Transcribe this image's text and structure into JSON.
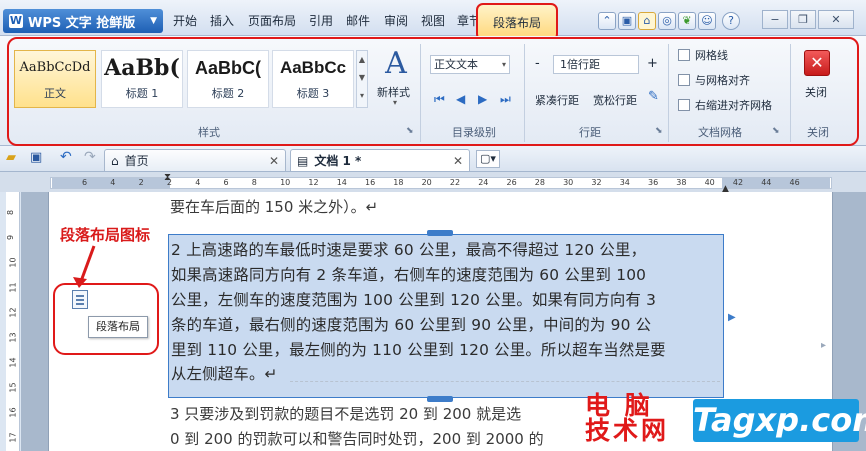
{
  "app": {
    "name": "WPS 文字 抢鲜版"
  },
  "menu": {
    "items": [
      "开始",
      "插入",
      "页面布局",
      "引用",
      "邮件",
      "审阅",
      "视图",
      "章节"
    ],
    "active": "段落布局"
  },
  "ribbon": {
    "styles": {
      "cards": [
        {
          "sample": "AaBbCcDd",
          "name": "正文"
        },
        {
          "sample": "AaBb(",
          "name": "标题 1"
        },
        {
          "sample": "AaBbC(",
          "name": "标题 2"
        },
        {
          "sample": "AaBbCc",
          "name": "标题 3"
        }
      ],
      "new_style": "新样式",
      "group_label": "样式"
    },
    "outline": {
      "select_value": "正文文本",
      "group_label": "目录级别"
    },
    "spacing": {
      "select_value": "1倍行距",
      "minus": "-",
      "plus": "+",
      "tight": "紧凑行距",
      "loose": "宽松行距",
      "group_label": "行距"
    },
    "grid": {
      "checkboxes": [
        "网格线",
        "与网格对齐",
        "右缩进对齐网格"
      ],
      "group_label": "文档网格"
    },
    "close": {
      "label": "关闭",
      "group_label": "关闭"
    }
  },
  "tabs": [
    {
      "label": "首页"
    },
    {
      "label": "文档 1 *"
    }
  ],
  "ruler": {
    "h_numbers": [
      "6",
      "4",
      "2",
      "2",
      "4",
      "6",
      "8",
      "10",
      "12",
      "14",
      "16",
      "18",
      "20",
      "22",
      "24",
      "26",
      "28",
      "30",
      "32",
      "34",
      "36",
      "38",
      "40",
      "42",
      "44",
      "46"
    ],
    "v_numbers": [
      "8",
      "9",
      "10",
      "11",
      "12",
      "13",
      "14",
      "15",
      "16",
      "17",
      "18"
    ]
  },
  "document": {
    "top_line": "要在车后面的 150 米之外）。↵",
    "selected_lines": [
      "2 上高速路的车最低时速是要求 60 公里，最高不得超过 120 公里，",
      "如果高速路同方向有 2 条车道，右侧车的速度范围为 60 公里到 100",
      "公里，左侧车的速度范围为 100 公里到 120 公里。如果有同方向有 3",
      "条的车道，最右侧的速度范围为 60 公里到 90 公里，中间的为 90 公",
      "里到 110 公里，最左侧的为 110 公里到 120 公里。所以超车当然是要",
      "从左侧超车。↵"
    ],
    "bottom_lines": [
      "3 只要涉及到罚款的题目不是选罚 20 到 200 就是选",
      "0 到 200 的罚款可以和警告同时处罚，200 到 2000 的"
    ]
  },
  "annotation": {
    "title": "段落布局图标",
    "tooltip": "段落布局"
  },
  "watermark": {
    "cn_line1": "电 脑",
    "cn_line2": "技术网",
    "en": "Tagxp.com"
  }
}
